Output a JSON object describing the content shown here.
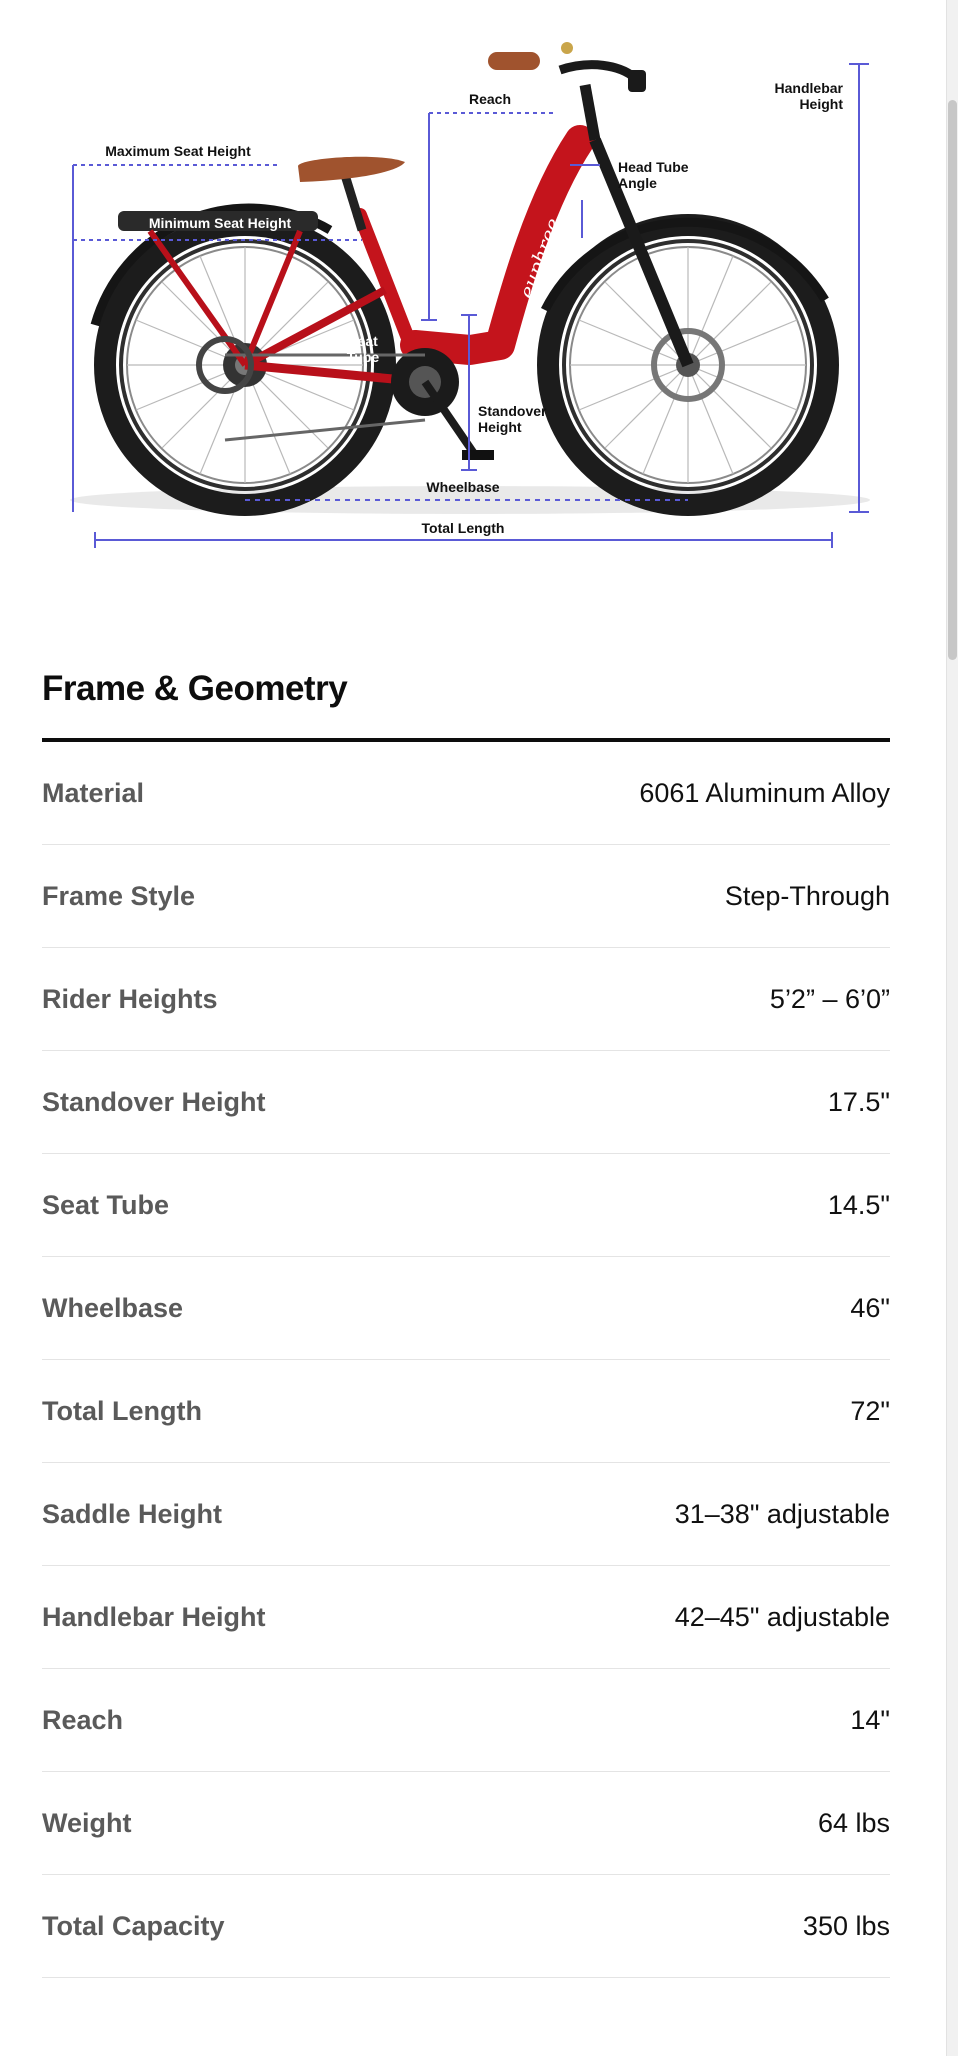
{
  "diagram": {
    "labels": {
      "reach": "Reach",
      "handlebar_height": [
        "Handlebar",
        "Height"
      ],
      "maximum_seat_height": "Maximum Seat Height",
      "minimum_seat_height": "Minimum Seat Height",
      "head_tube_angle": [
        "Head Tube",
        "Angle"
      ],
      "seat_tube": [
        "Seat",
        "Tube"
      ],
      "standover_height": [
        "Standover",
        "Height"
      ],
      "wheelbase": "Wheelbase",
      "total_length": "Total Length"
    },
    "brand_text": "euphree",
    "colors": {
      "frame": "#c4141c",
      "dimension_lines": "#5a5ad6",
      "saddle": "#a0532e",
      "tire": "#1c1c1c"
    }
  },
  "section": {
    "title": "Frame & Geometry"
  },
  "specs": [
    {
      "label": "Material",
      "value": "6061 Aluminum Alloy"
    },
    {
      "label": "Frame Style",
      "value": "Step-Through"
    },
    {
      "label": "Rider Heights",
      "value": "5’2” – 6’0”"
    },
    {
      "label": "Standover Height",
      "value": "17.5\""
    },
    {
      "label": "Seat Tube",
      "value": "14.5\""
    },
    {
      "label": "Wheelbase",
      "value": "46\""
    },
    {
      "label": "Total Length",
      "value": "72\""
    },
    {
      "label": "Saddle Height",
      "value": "31–38\" adjustable"
    },
    {
      "label": "Handlebar Height",
      "value": "42–45\" adjustable"
    },
    {
      "label": "Reach",
      "value": "14\""
    },
    {
      "label": "Weight",
      "value": "64 lbs"
    },
    {
      "label": "Total Capacity",
      "value": "350 lbs"
    }
  ]
}
